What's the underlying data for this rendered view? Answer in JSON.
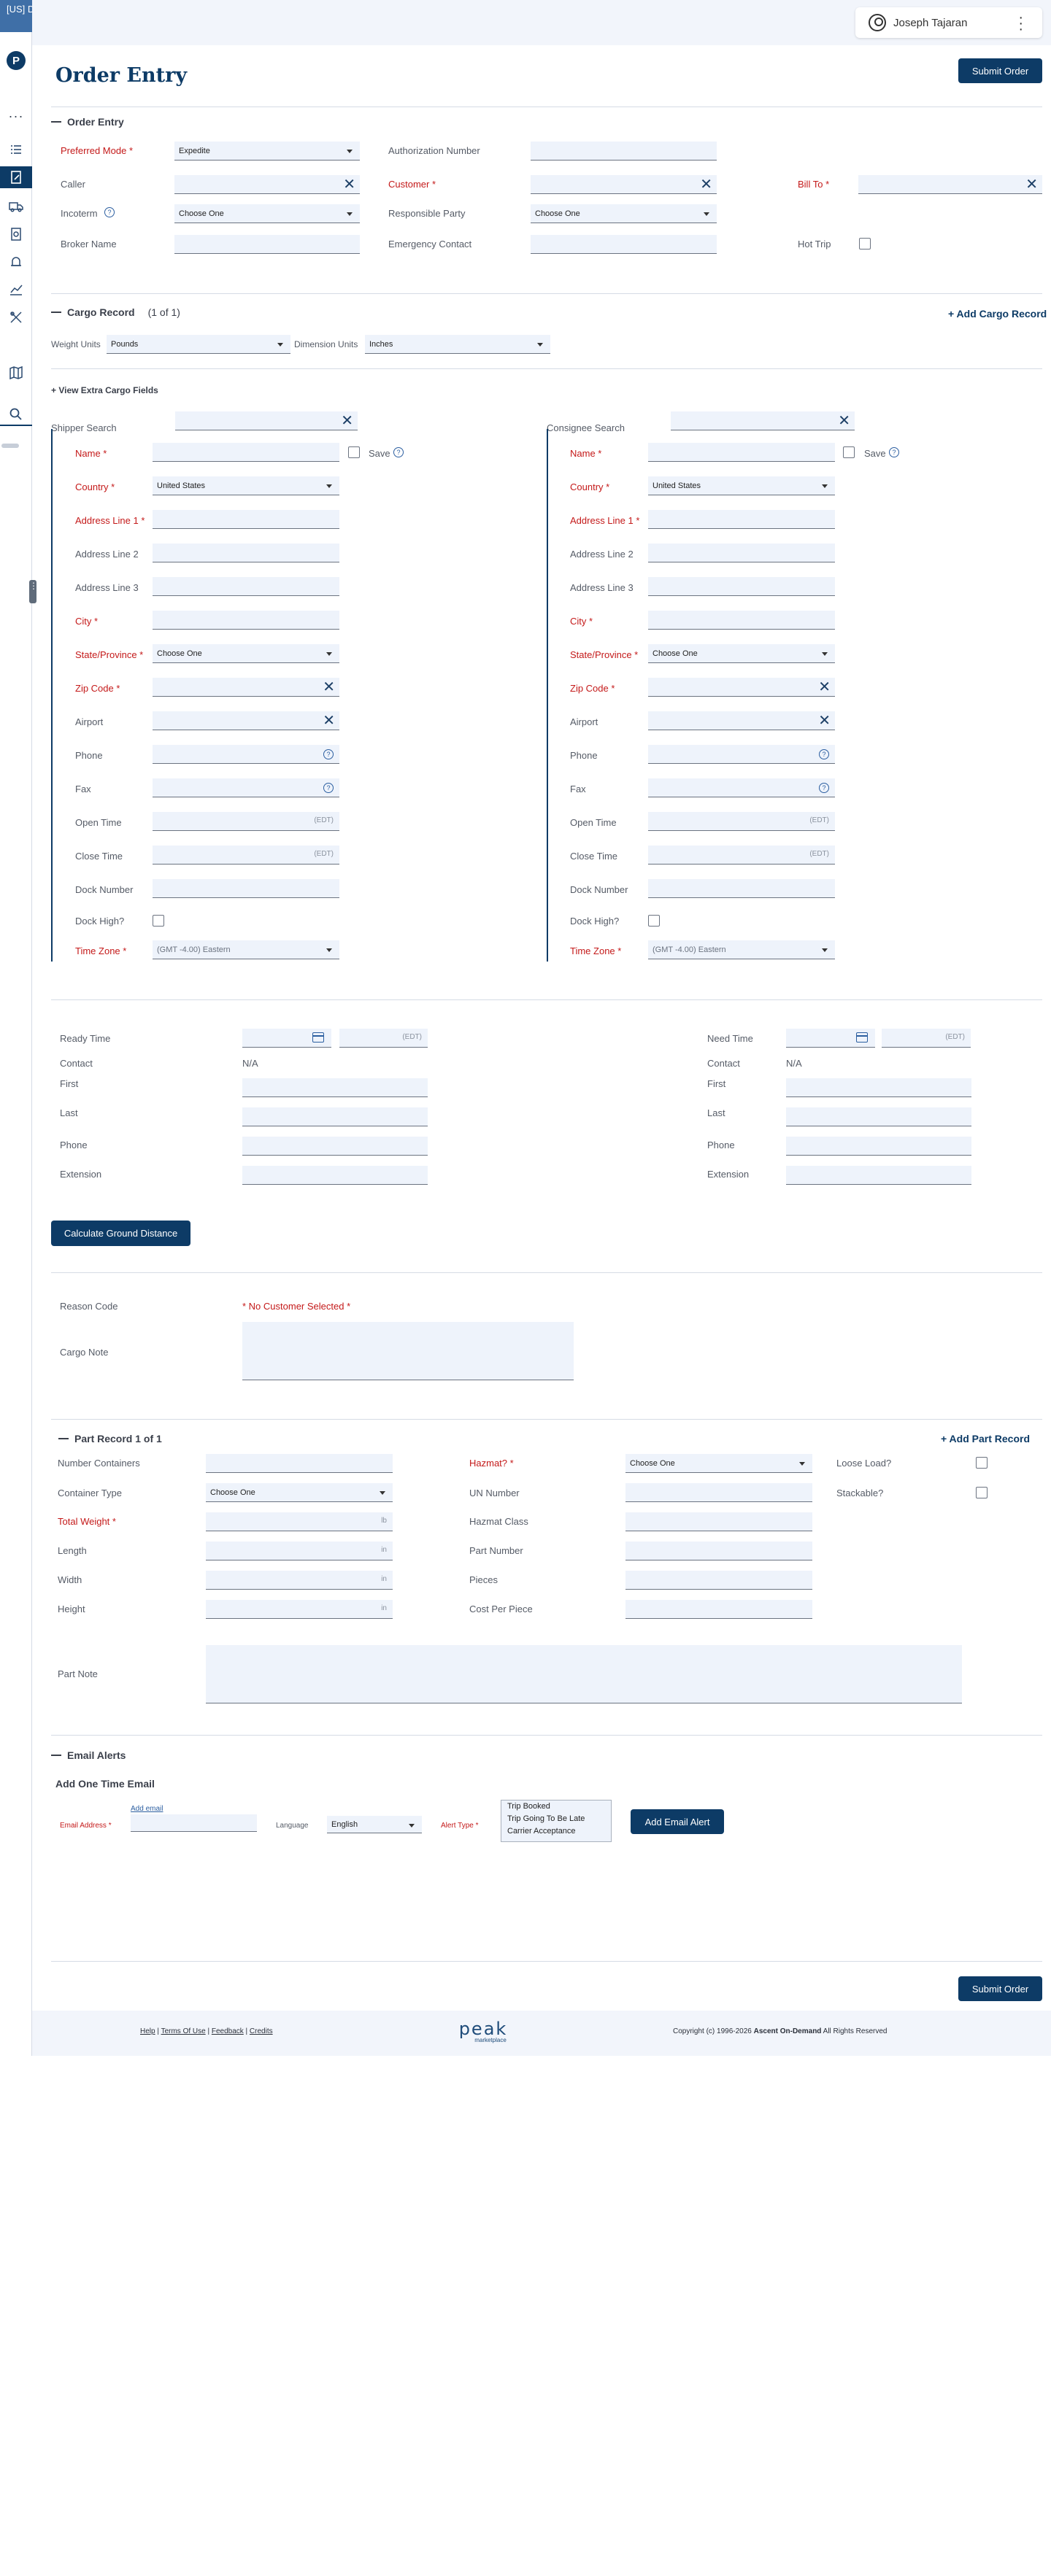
{
  "env_badge": "[US] Develop",
  "user_name": "Joseph Tajaran",
  "page_title": "Order Entry",
  "submit_label": "Submit Order",
  "order_entry": {
    "title": "Order Entry",
    "preferred_mode_label": "Preferred Mode",
    "preferred_mode_value": "Expedite",
    "authorization_number_label": "Authorization Number",
    "caller_label": "Caller",
    "customer_label": "Customer",
    "bill_to_label": "Bill To",
    "incoterm_label": "Incoterm",
    "incoterm_value": "Choose One",
    "responsible_party_label": "Responsible Party",
    "responsible_party_value": "Choose One",
    "broker_name_label": "Broker Name",
    "emergency_contact_label": "Emergency Contact",
    "hot_trip_label": "Hot Trip"
  },
  "cargo_record": {
    "title": "Cargo Record",
    "count": "(1 of 1)",
    "add_label": "+ Add Cargo Record",
    "weight_units_label": "Weight Units",
    "weight_units_value": "Pounds",
    "dimension_units_label": "Dimension Units",
    "dimension_units_value": "Inches",
    "view_extra_label": "View Extra Cargo Fields"
  },
  "shipper": {
    "search_label": "Shipper Search",
    "name_label": "Name",
    "save_label": "Save",
    "country_label": "Country",
    "country_value": "United States",
    "address1_label": "Address Line 1",
    "address2_label": "Address Line 2",
    "address3_label": "Address Line 3",
    "city_label": "City",
    "state_label": "State/Province",
    "state_value": "Choose One",
    "zip_label": "Zip Code",
    "airport_label": "Airport",
    "phone_label": "Phone",
    "fax_label": "Fax",
    "open_time_label": "Open Time",
    "close_time_label": "Close Time",
    "time_placeholder": "(EDT)",
    "dock_number_label": "Dock Number",
    "dock_high_label": "Dock High?",
    "time_zone_label": "Time Zone",
    "time_zone_value": "(GMT -4.00) Eastern"
  },
  "consignee": {
    "search_label": "Consignee Search",
    "name_label": "Name",
    "save_label": "Save",
    "country_label": "Country",
    "country_value": "United States",
    "address1_label": "Address Line 1",
    "address2_label": "Address Line 2",
    "address3_label": "Address Line 3",
    "city_label": "City",
    "state_label": "State/Province",
    "state_value": "Choose One",
    "zip_label": "Zip Code",
    "airport_label": "Airport",
    "phone_label": "Phone",
    "fax_label": "Fax",
    "open_time_label": "Open Time",
    "close_time_label": "Close Time",
    "time_placeholder": "(EDT)",
    "dock_number_label": "Dock Number",
    "dock_high_label": "Dock High?",
    "time_zone_label": "Time Zone",
    "time_zone_value": "(GMT -4.00) Eastern"
  },
  "ready": {
    "ready_time_label": "Ready Time",
    "need_time_label": "Need Time",
    "time_placeholder": "(EDT)",
    "contact_label": "Contact",
    "contact_value": "N/A",
    "first_label": "First",
    "last_label": "Last",
    "phone_label": "Phone",
    "extension_label": "Extension",
    "calculate_label": "Calculate Ground Distance"
  },
  "reason": {
    "reason_code_label": "Reason Code",
    "no_customer_text": "* No Customer Selected *",
    "cargo_note_label": "Cargo Note"
  },
  "part_record": {
    "title": "Part Record 1 of 1",
    "add_label": "+ Add Part Record",
    "number_containers_label": "Number Containers",
    "container_type_label": "Container Type",
    "container_type_value": "Choose One",
    "total_weight_label": "Total Weight",
    "length_label": "Length",
    "width_label": "Width",
    "height_label": "Height",
    "unit_lb": "lb",
    "unit_in": "in",
    "hazmat_label": "Hazmat?",
    "hazmat_value": "Choose One",
    "un_number_label": "UN Number",
    "hazmat_class_label": "Hazmat Class",
    "part_number_label": "Part Number",
    "pieces_label": "Pieces",
    "cost_per_piece_label": "Cost Per Piece",
    "loose_load_label": "Loose Load?",
    "stackable_label": "Stackable?",
    "part_note_label": "Part Note"
  },
  "email_alerts": {
    "title": "Email Alerts",
    "subtitle": "Add One Time Email",
    "email_address_label": "Email Address",
    "add_email_link": "Add email",
    "language_label": "Language",
    "language_value": "English",
    "alert_type_label": "Alert Type",
    "alert_options": [
      "Trip Booked",
      "Trip Going To Be Late",
      "Carrier Acceptance"
    ],
    "add_button": "Add Email Alert"
  },
  "footer": {
    "help": "Help",
    "terms": "Terms Of Use",
    "feedback": "Feedback",
    "credits": "Credits",
    "brand": "peak",
    "brand_sub": "marketplace",
    "copyright_prefix": "Copyright (c) 1996-2026",
    "copyright_company": "Ascent On-Demand",
    "copyright_suffix": "All Rights Reserved"
  }
}
